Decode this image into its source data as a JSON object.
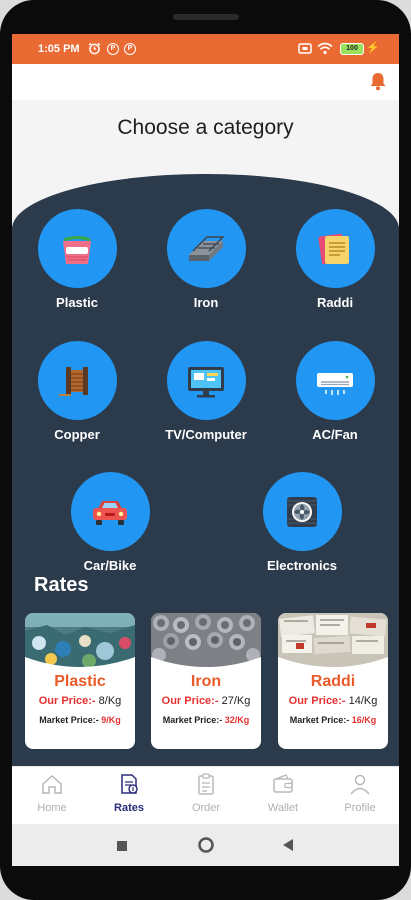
{
  "status": {
    "time": "1:05 PM",
    "battery": "100"
  },
  "colors": {
    "brand": "#ea6a34",
    "panel": "#2c3b4b",
    "circle": "#2196f3",
    "card_title": "#ea5a2a",
    "highlight": "#e53030"
  },
  "page": {
    "title": "Choose a category"
  },
  "categories": [
    {
      "label": "Plastic",
      "icon": "plastic-basket-icon"
    },
    {
      "label": "Iron",
      "icon": "iron-bars-icon"
    },
    {
      "label": "Raddi",
      "icon": "paper-stack-icon"
    },
    {
      "label": "Copper",
      "icon": "copper-spool-icon"
    },
    {
      "label": "TV/Computer",
      "icon": "computer-monitor-icon"
    },
    {
      "label": "AC/Fan",
      "icon": "air-conditioner-icon"
    },
    {
      "label": "Car/Bike",
      "icon": "car-icon"
    },
    {
      "label": "Electronics",
      "icon": "cpu-fan-icon"
    }
  ],
  "rates": {
    "title": "Rates",
    "cards": [
      {
        "name": "Plastic",
        "our_price_label": "Our Price:-",
        "our_price": "8/Kg",
        "market_label": "Market Price:-",
        "market_price": "9/Kg"
      },
      {
        "name": "Iron",
        "our_price_label": "Our Price:-",
        "our_price": "27/Kg",
        "market_label": "Market Price:-",
        "market_price": "32/Kg"
      },
      {
        "name": "Raddi",
        "our_price_label": "Our Price:-",
        "our_price": "14/Kg",
        "market_label": "Market Price:-",
        "market_price": "16/Kg"
      }
    ]
  },
  "nav": {
    "items": [
      {
        "label": "Home",
        "icon": "home-icon"
      },
      {
        "label": "Rates",
        "icon": "rates-icon",
        "active": true
      },
      {
        "label": "Order",
        "icon": "clipboard-icon"
      },
      {
        "label": "Wallet",
        "icon": "wallet-icon"
      },
      {
        "label": "Profile",
        "icon": "profile-icon"
      }
    ]
  }
}
